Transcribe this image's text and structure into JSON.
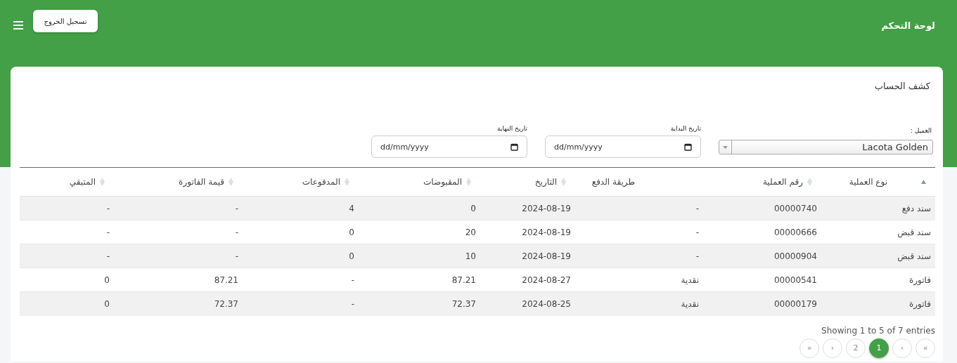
{
  "navbar": {
    "title": "لوحة التحكم",
    "logout_button": "تسجيل الخروج"
  },
  "card": {
    "title": "كشف الحساب",
    "filters": {
      "customer": {
        "label": "العميل :",
        "value": "Lacota Golden"
      },
      "start_date": {
        "label": "تاريخ البداية",
        "placeholder": "dd/mm/yyyy"
      },
      "end_date": {
        "label": "تاريخ النهاية",
        "placeholder": "dd/mm/yyyy"
      }
    },
    "table": {
      "columns": [
        {
          "label": "نوع العملية",
          "sortable": true,
          "sorted_ascending": true
        },
        {
          "label": "رقم العملية",
          "sortable": true,
          "sorted_ascending": false
        },
        {
          "label": "طريقة الدفع",
          "sortable": false
        },
        {
          "label": "التاريخ",
          "sortable": true,
          "sorted_ascending": false
        },
        {
          "label": "المقبوضات",
          "sortable": true,
          "sorted_ascending": false
        },
        {
          "label": "المدفوعات",
          "sortable": true,
          "sorted_ascending": false
        },
        {
          "label": "قيمة الفاتورة",
          "sortable": true,
          "sorted_ascending": false
        },
        {
          "label": "المتبقي",
          "sortable": true,
          "sorted_ascending": false
        }
      ],
      "rows": [
        [
          "سند دفع",
          "00000740",
          "-",
          "2024-08-19",
          "0",
          "4",
          "-",
          "-"
        ],
        [
          "سند قبض",
          "00000666",
          "-",
          "2024-08-19",
          "20",
          "0",
          "-",
          "-"
        ],
        [
          "سند قبض",
          "00000904",
          "-",
          "2024-08-19",
          "10",
          "0",
          "-",
          "-"
        ],
        [
          "فاتورة",
          "00000541",
          "نقدية",
          "2024-08-27",
          "87.21",
          "-",
          "87.21",
          "0"
        ],
        [
          "فاتورة",
          "00000179",
          "نقدية",
          "2024-08-25",
          "72.37",
          "-",
          "72.37",
          "0"
        ]
      ]
    },
    "info": "Showing 1 to 5 of 7 entries",
    "pagination": [
      {
        "label": "»",
        "selected": false
      },
      {
        "label": "›",
        "selected": false
      },
      {
        "label": "1",
        "selected": true
      },
      {
        "label": "2",
        "selected": false
      },
      {
        "label": "‹",
        "selected": false
      },
      {
        "label": "«",
        "selected": false
      }
    ]
  }
}
